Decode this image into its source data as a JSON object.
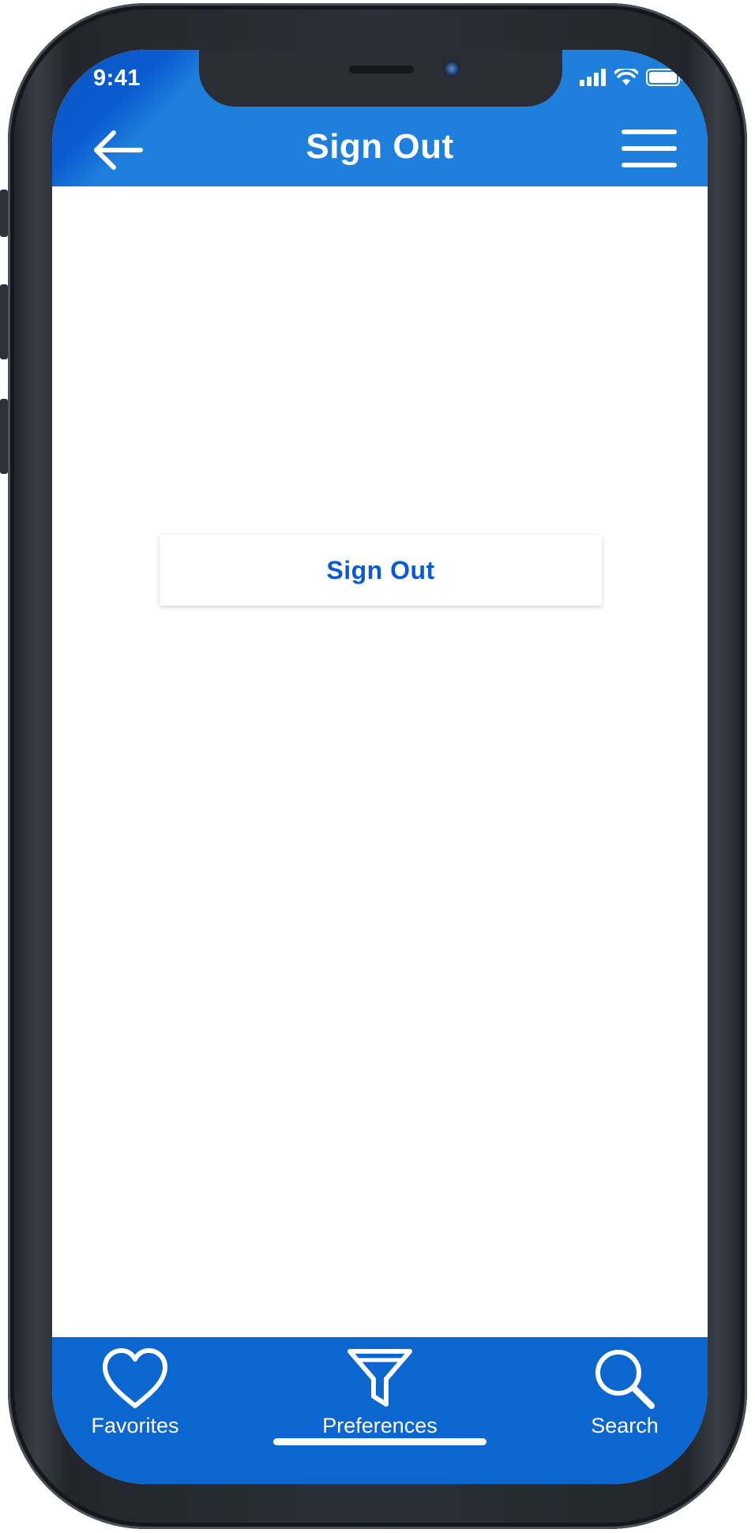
{
  "status_bar": {
    "time": "9:41"
  },
  "header": {
    "title": "Sign Out",
    "back_icon": "arrow-left-icon",
    "menu_icon": "hamburger-menu-icon"
  },
  "main": {
    "signout_label": "Sign Out"
  },
  "tabbar": {
    "items": [
      {
        "label": "Favorites",
        "icon": "heart-icon"
      },
      {
        "label": "Preferences",
        "icon": "filter-icon"
      },
      {
        "label": "Search",
        "icon": "search-icon"
      }
    ]
  },
  "colors": {
    "primary": "#0b66d0",
    "header": "#1e7fdc",
    "button_text": "#0b5bd0",
    "background": "#ffffff"
  }
}
